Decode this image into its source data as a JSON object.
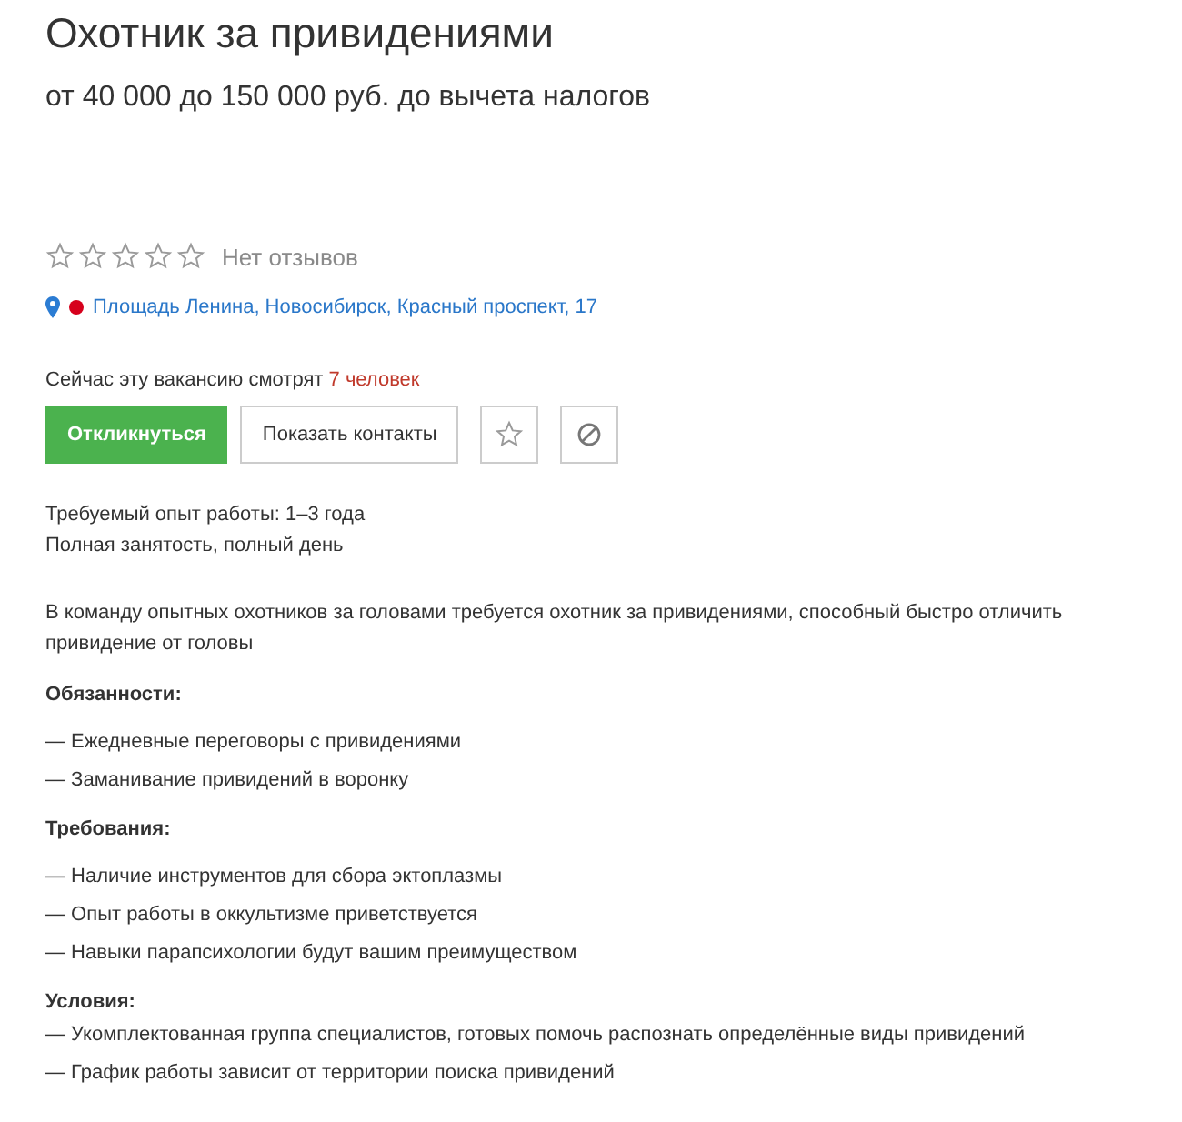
{
  "title": "Охотник за привидениями",
  "salary": "от 40 000 до 150 000 руб. до вычета налогов",
  "rating": {
    "stars": 0,
    "label": "Нет отзывов"
  },
  "address": {
    "text": "Площадь Ленина, Новосибирск, Красный проспект, 17"
  },
  "viewers": {
    "text": "Сейчас эту вакансию смотрят ",
    "count": "7 человек"
  },
  "buttons": [
    {
      "kind": "primary",
      "label": "Откликнуться"
    },
    {
      "kind": "secondary",
      "label": "Показать контакты"
    },
    {
      "kind": "favorite"
    },
    {
      "kind": "hide"
    }
  ],
  "facts": [
    "Требуемый опыт работы: 1–3 года",
    "Полная занятость, полный день"
  ],
  "description": "В команду опытных охотников за головами требуется охотник за привидениями, способный быстро отличить привидение от головы",
  "sections": [
    {
      "heading": "Обязанности:",
      "items": [
        "— Ежедневные переговоры с привидениями",
        "— Заманивание привидений в воронку"
      ]
    },
    {
      "heading": "Требования:",
      "items": [
        "— Наличие инструментов для сбора эктоплазмы",
        "— Опыт работы в оккультизме приветствуется",
        "— Навыки парапсихологии будут вашим преимуществом"
      ]
    },
    {
      "heading": "Условия:",
      "items": [
        "— Укомплектованная группа специалистов, готовых помочь распознать определённые виды привидений",
        "— График работы зависит от территории поиска привидений"
      ]
    }
  ]
}
